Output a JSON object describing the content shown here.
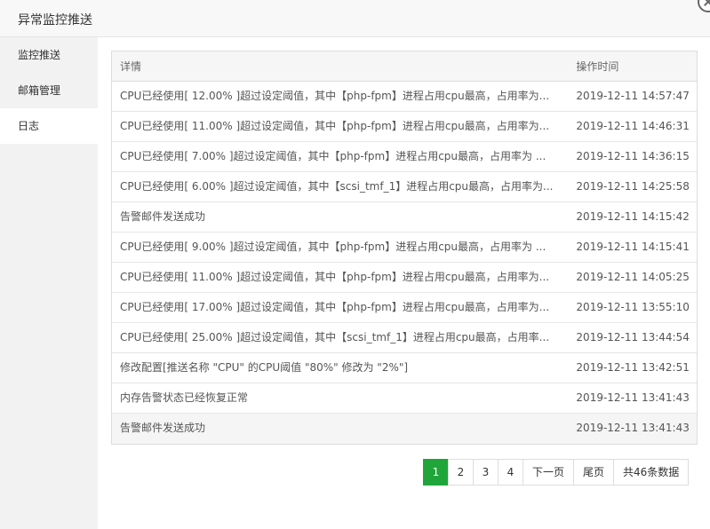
{
  "window": {
    "title": "异常监控推送"
  },
  "sidebar": {
    "items": [
      {
        "label": "监控推送"
      },
      {
        "label": "邮箱管理"
      },
      {
        "label": "日志"
      }
    ]
  },
  "table": {
    "columns": {
      "detail": "详情",
      "time": "操作时间"
    },
    "rows": [
      {
        "detail": "CPU已经使用[ 12.00% ]超过设定阈值，其中【php-fpm】进程占用cpu最高，占用率为...",
        "time": "2019-12-11 14:57:47"
      },
      {
        "detail": "CPU已经使用[ 11.00% ]超过设定阈值，其中【php-fpm】进程占用cpu最高，占用率为...",
        "time": "2019-12-11 14:46:31"
      },
      {
        "detail": "CPU已经使用[ 7.00% ]超过设定阈值，其中【php-fpm】进程占用cpu最高，占用率为 ...",
        "time": "2019-12-11 14:36:15"
      },
      {
        "detail": "CPU已经使用[ 6.00% ]超过设定阈值，其中【scsi_tmf_1】进程占用cpu最高，占用率为...",
        "time": "2019-12-11 14:25:58"
      },
      {
        "detail": "告警邮件发送成功",
        "time": "2019-12-11 14:15:42"
      },
      {
        "detail": "CPU已经使用[ 9.00% ]超过设定阈值，其中【php-fpm】进程占用cpu最高，占用率为 ...",
        "time": "2019-12-11 14:15:41"
      },
      {
        "detail": "CPU已经使用[ 11.00% ]超过设定阈值，其中【php-fpm】进程占用cpu最高，占用率为...",
        "time": "2019-12-11 14:05:25"
      },
      {
        "detail": "CPU已经使用[ 17.00% ]超过设定阈值，其中【php-fpm】进程占用cpu最高，占用率为...",
        "time": "2019-12-11 13:55:10"
      },
      {
        "detail": "CPU已经使用[ 25.00% ]超过设定阈值，其中【scsi_tmf_1】进程占用cpu最高，占用率...",
        "time": "2019-12-11 13:44:54"
      },
      {
        "detail": "修改配置[推送名称 \"CPU\" 的CPU阈值 \"80%\" 修改为 \"2%\"]",
        "time": "2019-12-11 13:42:51"
      },
      {
        "detail": "内存告警状态已经恢复正常",
        "time": "2019-12-11 13:41:43"
      },
      {
        "detail": "告警邮件发送成功",
        "time": "2019-12-11 13:41:43"
      }
    ]
  },
  "pagination": {
    "pages": [
      "1",
      "2",
      "3",
      "4"
    ],
    "next": "下一页",
    "last": "尾页",
    "total": "共46条数据"
  },
  "colors": {
    "accent": "#20a53a"
  }
}
